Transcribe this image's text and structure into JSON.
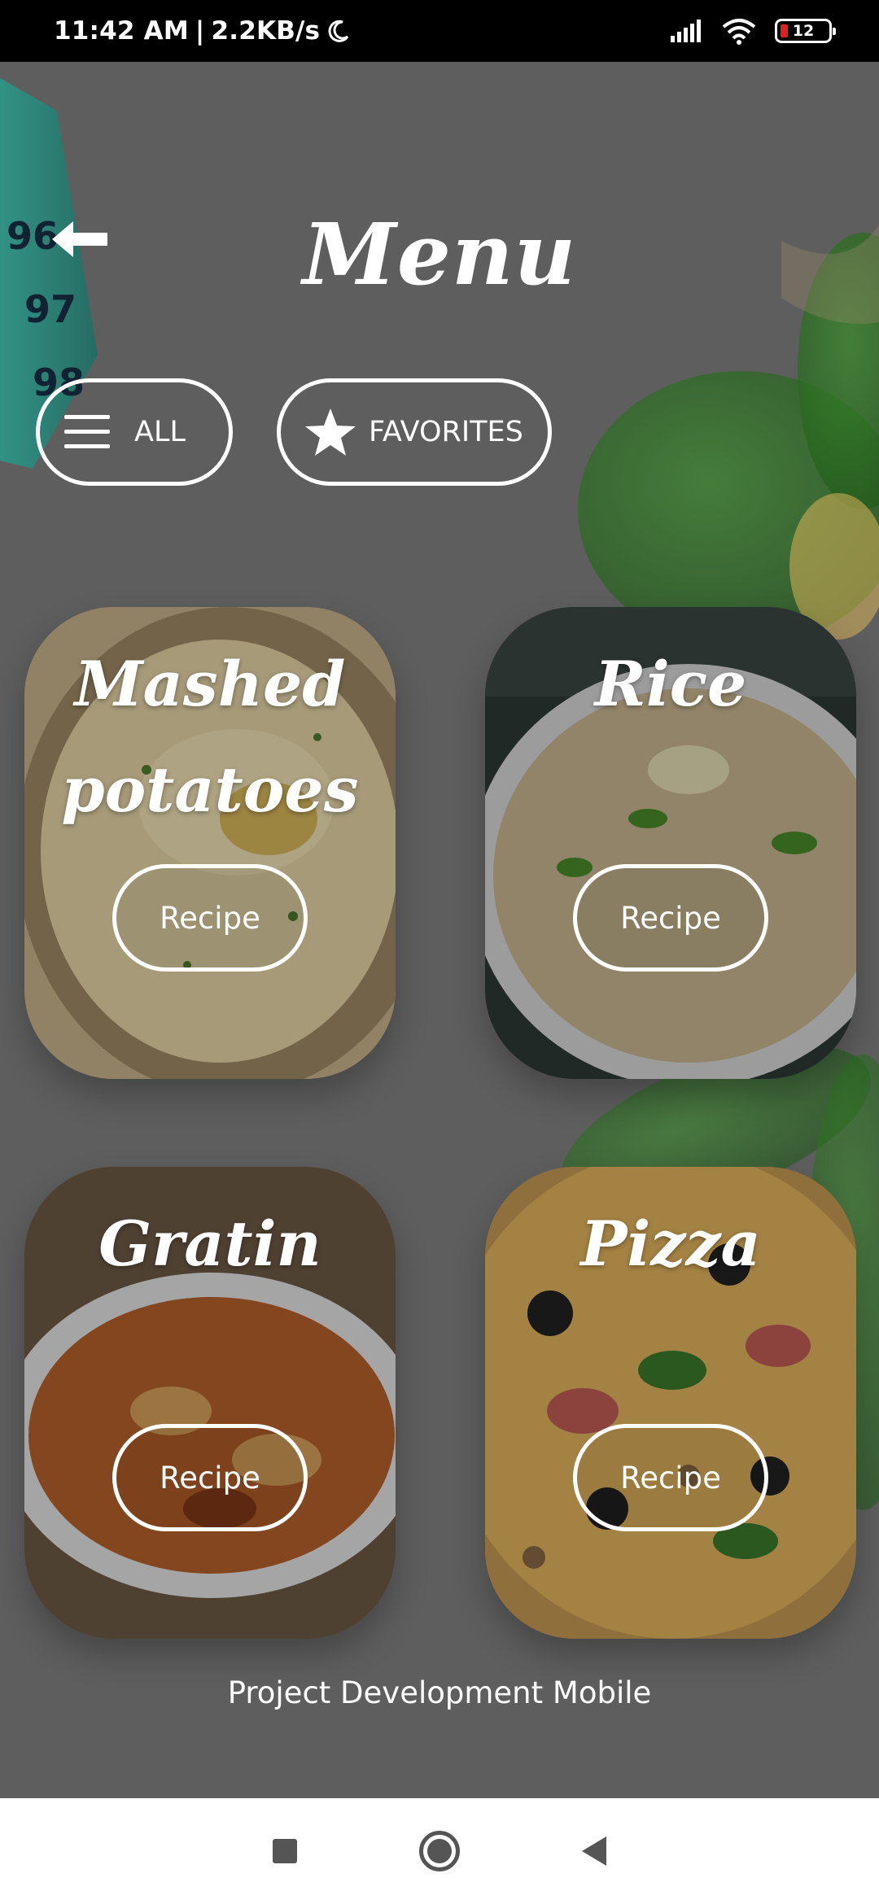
{
  "status_bar": {
    "time": "11:42 AM",
    "separator": "|",
    "speed": "2.2KB/s",
    "battery_level": "12",
    "icons": [
      "moon-icon",
      "signal-icon",
      "wifi-icon",
      "battery-icon"
    ]
  },
  "header": {
    "title": "Menu",
    "back_icon": "back-arrow-icon"
  },
  "filters": [
    {
      "label": "ALL",
      "icon": "menu-lines-icon"
    },
    {
      "label": "FAVORITES",
      "icon": "star-icon"
    }
  ],
  "dishes": [
    {
      "title_line1": "Mashed",
      "title_line2": "potatoes",
      "button": "Recipe"
    },
    {
      "title_line1": "Rice",
      "title_line2": "",
      "button": "Recipe"
    },
    {
      "title_line1": "Gratin",
      "title_line2": "",
      "button": "Recipe"
    },
    {
      "title_line1": "Pizza",
      "title_line2": "",
      "button": "Recipe"
    }
  ],
  "footer": {
    "text": "Project Development Mobile"
  },
  "nav_bar": {
    "icons": [
      "recents-square-icon",
      "home-circle-icon",
      "back-triangle-icon"
    ]
  },
  "colors": {
    "overlay": "#5f5f5f",
    "accent_green": "#2e7d32",
    "white": "#ffffff"
  }
}
